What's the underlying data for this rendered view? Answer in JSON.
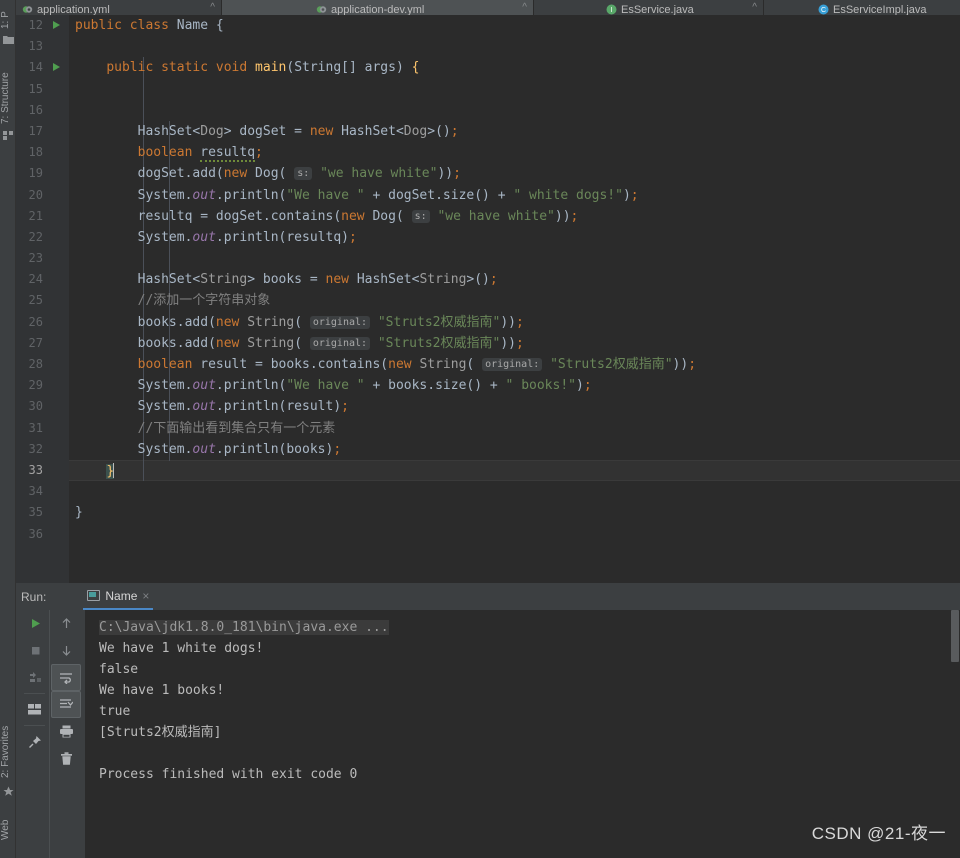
{
  "editor_tabs": [
    {
      "label": "application.yml",
      "icon": "yaml-file-icon",
      "icon_color": "#5a9e5a",
      "active": false
    },
    {
      "label": "application-dev.yml",
      "icon": "yaml-file-icon",
      "icon_color": "#5a9e5a",
      "active": true
    },
    {
      "label": "EsService.java",
      "icon": "java-interface-icon",
      "icon_color": "#59a869",
      "active": false
    },
    {
      "label": "EsServiceImpl.java",
      "icon": "java-class-icon",
      "icon_color": "#389fd6",
      "active": false
    }
  ],
  "left_strip": {
    "top_label": "1: P",
    "structure_label": "7: Structure",
    "favorites_label": "2: Favorites",
    "web_label": "Web"
  },
  "gutter": {
    "first_line": 12,
    "last_line": 36,
    "current_line": 33,
    "run_marker_lines": [
      12,
      14
    ]
  },
  "code_lines": [
    {
      "n": 12,
      "text": "public class Name {"
    },
    {
      "n": 13,
      "text": ""
    },
    {
      "n": 14,
      "text": "    public static void main(String[] args) {"
    },
    {
      "n": 15,
      "text": ""
    },
    {
      "n": 16,
      "text": ""
    },
    {
      "n": 17,
      "text": "        HashSet<Dog> dogSet = new HashSet<Dog>();"
    },
    {
      "n": 18,
      "text": "        boolean resultq;"
    },
    {
      "n": 19,
      "text": "        dogSet.add(new Dog( s: \"we have white\"));"
    },
    {
      "n": 20,
      "text": "        System.out.println(\"We have \" + dogSet.size() + \" white dogs!\");"
    },
    {
      "n": 21,
      "text": "        resultq = dogSet.contains(new Dog( s: \"we have white\"));"
    },
    {
      "n": 22,
      "text": "        System.out.println(resultq);"
    },
    {
      "n": 23,
      "text": ""
    },
    {
      "n": 24,
      "text": "        HashSet<String> books = new HashSet<String>();"
    },
    {
      "n": 25,
      "text": "        //添加一个字符串对象"
    },
    {
      "n": 26,
      "text": "        books.add(new String( original: \"Struts2权威指南\"));"
    },
    {
      "n": 27,
      "text": "        books.add(new String( original: \"Struts2权威指南\"));"
    },
    {
      "n": 28,
      "text": "        boolean result = books.contains(new String( original: \"Struts2权威指南\"));"
    },
    {
      "n": 29,
      "text": "        System.out.println(\"We have \" + books.size() + \" books!\");"
    },
    {
      "n": 30,
      "text": "        System.out.println(result);"
    },
    {
      "n": 31,
      "text": "        //下面输出看到集合只有一个元素"
    },
    {
      "n": 32,
      "text": "        System.out.println(books);"
    },
    {
      "n": 33,
      "text": "    }"
    },
    {
      "n": 34,
      "text": ""
    },
    {
      "n": 35,
      "text": "}"
    },
    {
      "n": 36,
      "text": ""
    }
  ],
  "code_tokens": {
    "kw_public": "public",
    "kw_class": "class",
    "kw_static": "static",
    "kw_void": "void",
    "kw_new": "new",
    "kw_boolean": "boolean",
    "name_class": "Name",
    "main": "main",
    "string_type": "String",
    "args": "args",
    "hashset": "HashSet",
    "dog": "Dog",
    "dogset": "dogSet",
    "books": "books",
    "resultq": "resultq",
    "result": "result",
    "system": "System",
    "out": "out",
    "println": "println",
    "add": "add",
    "contains": "contains",
    "size": "size",
    "hint_s": "s:",
    "hint_original": "original:",
    "str_we_have_white": "\"we have white\"",
    "str_we_have": "\"We have \"",
    "str_white_dogs": "\" white dogs!\"",
    "str_books": "\" books!\"",
    "str_struts": "\"Struts2权威指南\"",
    "comment_add_string": "//添加一个字符串对象",
    "comment_output_one": "//下面输出看到集合只有一个元素"
  },
  "run_panel": {
    "run_label": "Run:",
    "tab_name": "Name",
    "tab_close": "×",
    "toolbar_left": [
      {
        "name": "rerun-button",
        "icon": "play-icon"
      },
      {
        "name": "stop-button",
        "icon": "stop-icon"
      },
      {
        "name": "rerun-failed-button",
        "icon": "rerun-failed-icon"
      },
      {
        "name": "layout-button",
        "icon": "layout-icon"
      },
      {
        "name": "pin-tab-button",
        "icon": "pin-icon"
      }
    ],
    "toolbar_right": [
      {
        "name": "up-stacktrace-button",
        "icon": "arrow-up-icon",
        "selected": false
      },
      {
        "name": "down-stacktrace-button",
        "icon": "arrow-down-icon",
        "selected": false
      },
      {
        "name": "soft-wrap-button",
        "icon": "soft-wrap-icon",
        "selected": true
      },
      {
        "name": "scroll-to-end-button",
        "icon": "scroll-end-icon",
        "selected": true
      },
      {
        "name": "print-button",
        "icon": "printer-icon",
        "selected": false
      },
      {
        "name": "clear-all-button",
        "icon": "trash-icon",
        "selected": false
      }
    ]
  },
  "console_output": [
    {
      "text": "C:\\Java\\jdk1.8.0_181\\bin\\java.exe ...",
      "kind": "command"
    },
    {
      "text": "We have 1 white dogs!",
      "kind": "stdout"
    },
    {
      "text": "false",
      "kind": "stdout"
    },
    {
      "text": "We have 1 books!",
      "kind": "stdout"
    },
    {
      "text": "true",
      "kind": "stdout"
    },
    {
      "text": "[Struts2权威指南]",
      "kind": "stdout"
    },
    {
      "text": "",
      "kind": "stdout"
    },
    {
      "text": "Process finished with exit code 0",
      "kind": "stdout"
    }
  ],
  "watermark": "CSDN @21-夜一",
  "colors": {
    "editor_bg": "#2b2b2b",
    "gutter_bg": "#313335",
    "panel_bg": "#3c3f41",
    "keyword": "#cc7832",
    "string": "#6a8759",
    "comment": "#808080",
    "field": "#9876aa",
    "text": "#a9b7c6",
    "tab_underline": "#4a88c7",
    "run_green": "#4f9e4f"
  }
}
